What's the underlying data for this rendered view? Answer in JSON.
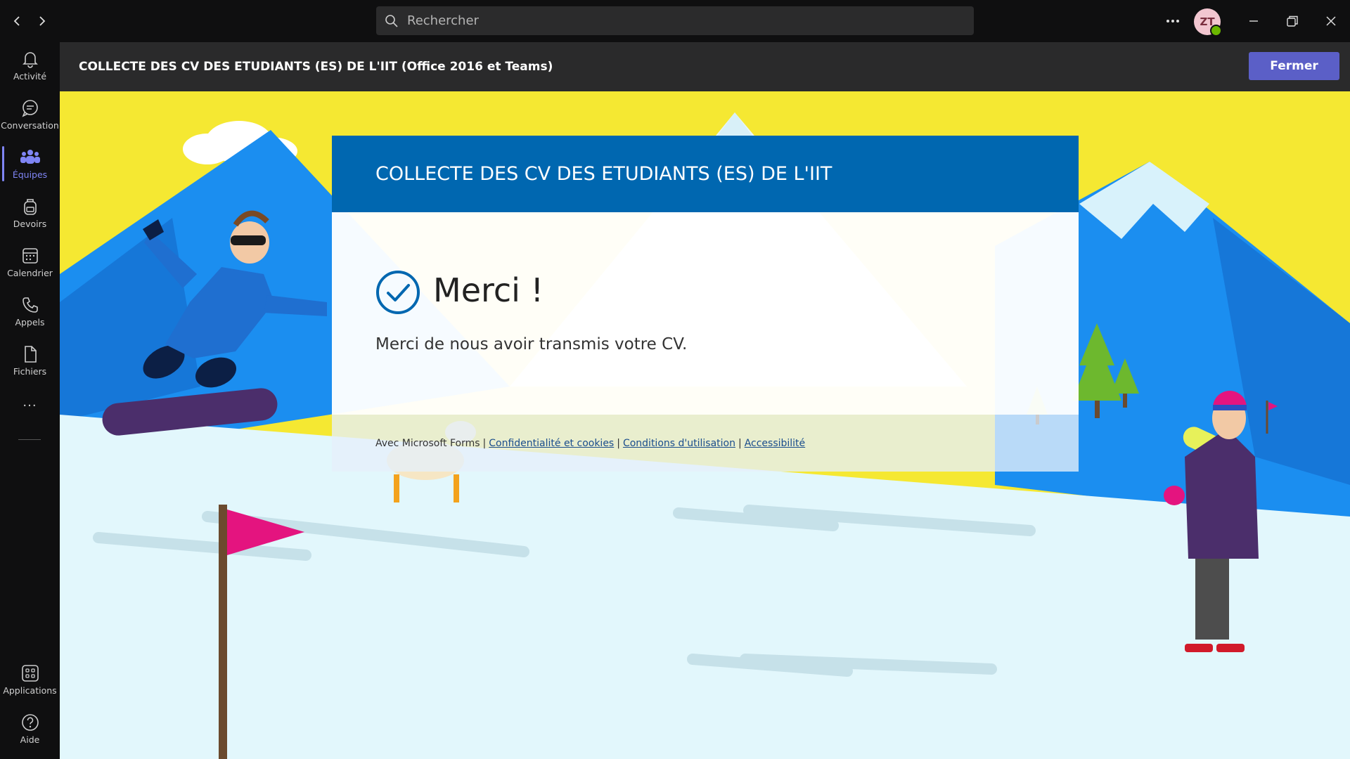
{
  "titlebar": {
    "search_placeholder": "Rechercher",
    "avatar_initials": "ZT"
  },
  "rail": {
    "items": [
      {
        "label": "Activité",
        "icon": "bell-icon"
      },
      {
        "label": "Conversation",
        "icon": "chat-icon"
      },
      {
        "label": "Équipes",
        "icon": "teams-icon"
      },
      {
        "label": "Devoirs",
        "icon": "backpack-icon"
      },
      {
        "label": "Calendrier",
        "icon": "calendar-icon"
      },
      {
        "label": "Appels",
        "icon": "phone-icon"
      },
      {
        "label": "Fichiers",
        "icon": "file-icon"
      }
    ],
    "more": "...",
    "bottom": [
      {
        "label": "Applications",
        "icon": "apps-icon"
      },
      {
        "label": "Aide",
        "icon": "help-icon"
      }
    ],
    "active_index": 2
  },
  "header": {
    "title": "COLLECTE DES CV DES ETUDIANTS (ES) DE L'IIT (Office 2016 et Teams)",
    "close_label": "Fermer"
  },
  "form": {
    "title": "COLLECTE DES CV DES ETUDIANTS (ES) DE L'IIT",
    "thanks_title": "Merci !",
    "thanks_text": "Merci de nous avoir transmis votre CV.",
    "footer_prefix": "Avec Microsoft Forms",
    "footer_links": [
      "Confidentialité et cookies",
      "Conditions d'utilisation",
      "Accessibilité"
    ]
  },
  "colors": {
    "accent": "#5b5fc7",
    "form_header": "#0067b0",
    "sky": "#f5e832",
    "mountain": "#1b8ef0",
    "snow": "#e2f7fc",
    "flag": "#e4147f"
  }
}
